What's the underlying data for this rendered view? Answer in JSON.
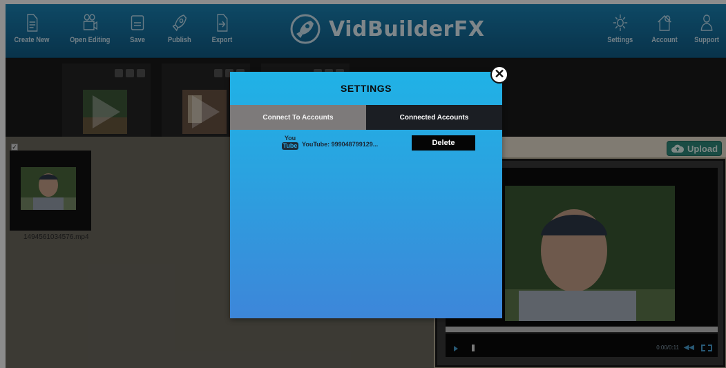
{
  "app": {
    "logo_text": "VidBuilderFX",
    "brand_color": "#1578a8"
  },
  "toolbar": {
    "left_tools": [
      {
        "label": "Create New",
        "icon": "document-icon"
      },
      {
        "label": "Open Editing",
        "icon": "camera-icon"
      },
      {
        "label": "Save",
        "icon": "save-icon"
      },
      {
        "label": "Publish",
        "icon": "rocket-icon"
      },
      {
        "label": "Export",
        "icon": "export-icon"
      }
    ],
    "right_tools": [
      {
        "label": "Settings",
        "icon": "gear-icon"
      },
      {
        "label": "Account",
        "icon": "home-dollar-icon"
      },
      {
        "label": "Support",
        "icon": "support-icon"
      }
    ]
  },
  "media": {
    "filename": "1494561034576.mp4",
    "upload_label": "Upload"
  },
  "player": {
    "time": "0:00/0:11"
  },
  "settings_modal": {
    "title": "SETTINGS",
    "close_glyph": "✕",
    "tabs": [
      {
        "label": "Connect To Accounts"
      },
      {
        "label": "Connected Accounts"
      }
    ],
    "account": {
      "service_icon_top": "You",
      "service_icon_bottom": "Tube",
      "label": "YouTube: 999048799129..."
    },
    "delete_label": "Delete"
  }
}
